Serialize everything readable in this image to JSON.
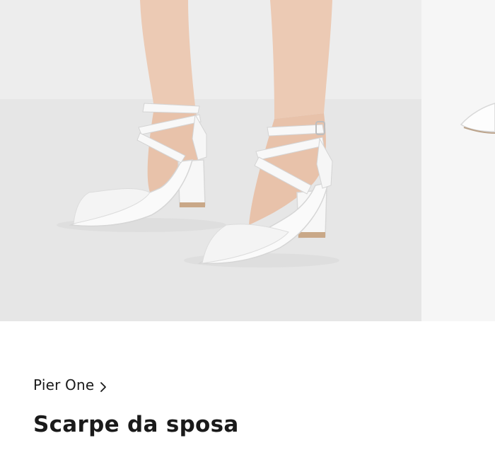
{
  "product": {
    "brand": "Pier One",
    "title": "Scarpe da sposa"
  },
  "gallery": {
    "images": [
      {
        "alt": "white-pointed-block-heel-pumps-with-crossed-ankle-straps"
      },
      {
        "alt": "white-shoe-partial-view"
      }
    ]
  },
  "icons": {
    "brand_chevron": "chevron-right-icon"
  },
  "colors": {
    "text": "#1a1a1a",
    "shoe": "#fafafa",
    "background": "#e8e8e8"
  }
}
